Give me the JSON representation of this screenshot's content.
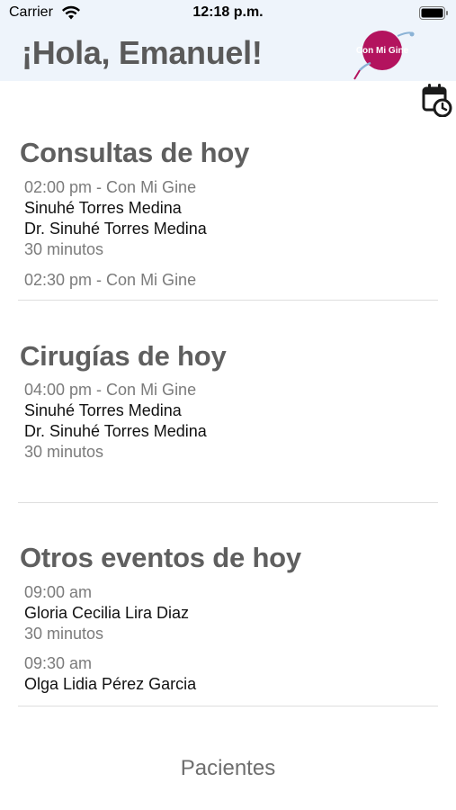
{
  "status_bar": {
    "carrier": "Carrier",
    "time": "12:18 p.m.",
    "wifi_icon": "wifi-icon",
    "battery_icon": "battery-icon"
  },
  "header": {
    "greeting": "¡Hola, Emanuel!",
    "logo_text": "Con Mi Gine",
    "logo_color": "#b3135e",
    "background": "#eef4fb"
  },
  "calendar_icon": "calendar-clock-icon",
  "sections": [
    {
      "title": "Consultas de hoy",
      "events": [
        {
          "time": "02:00 pm - Con Mi Gine",
          "patient": "Sinuhé Torres Medina",
          "doctor": "Dr. Sinuhé Torres Medina",
          "duration": "30 minutos"
        },
        {
          "time": "02:30 pm - Con Mi Gine"
        }
      ]
    },
    {
      "title": "Cirugías de hoy",
      "events": [
        {
          "time": "04:00 pm - Con Mi Gine",
          "patient": "Sinuhé Torres Medina",
          "doctor": "Dr. Sinuhé Torres Medina",
          "duration": "30 minutos"
        }
      ]
    },
    {
      "title": "Otros eventos de hoy",
      "events": [
        {
          "time": "09:00 am",
          "patient": "Gloria Cecilia Lira Diaz",
          "duration": "30 minutos"
        },
        {
          "time": "09:30 am",
          "patient": "Olga Lidia Pérez Garcia"
        }
      ]
    }
  ],
  "footer": {
    "link_label": "Pacientes"
  }
}
